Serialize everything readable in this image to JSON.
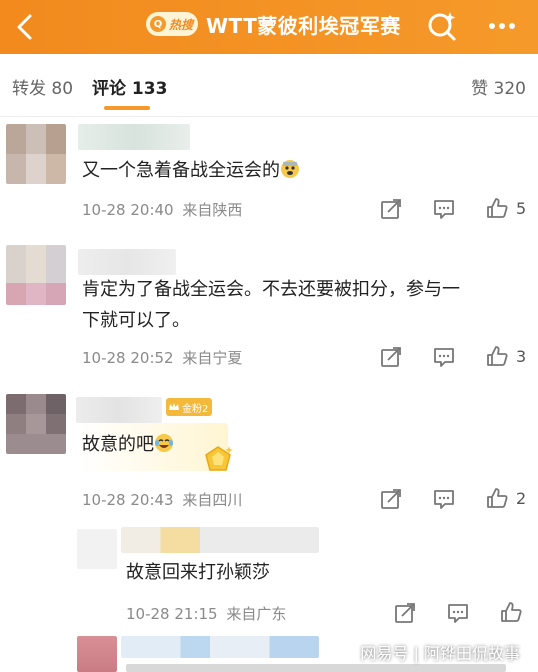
{
  "header": {
    "hot_label": "热搜",
    "topic_title": "WTT蒙彼利埃冠军赛",
    "accent_color": "#f28a1e"
  },
  "tabs": {
    "repost": "转发 80",
    "comments": "评论 133",
    "likes": "赞 320"
  },
  "comments": [
    {
      "text": "又一个急着备战全运会的",
      "emoji": "scared-face-emoji",
      "time": "10-28 20:40",
      "location": "来自陕西",
      "likes": "5"
    },
    {
      "text_line1": "肯定为了备战全运会。不去还要被扣分，参与一",
      "text_line2": "下就可以了。",
      "time": "10-28 20:52",
      "location": "来自宁夏",
      "likes": "3"
    },
    {
      "fan_badge": "金粉2",
      "text": "故意的吧",
      "emoji": "laughing-crying-emoji",
      "time": "10-28 20:43",
      "location": "来自四川",
      "likes": "2"
    },
    {
      "text": "故意回来打孙颖莎",
      "time": "10-28 21:15",
      "location": "来自广东",
      "likes": ""
    }
  ],
  "watermark": "网易号 | 阿铧田侃故事"
}
